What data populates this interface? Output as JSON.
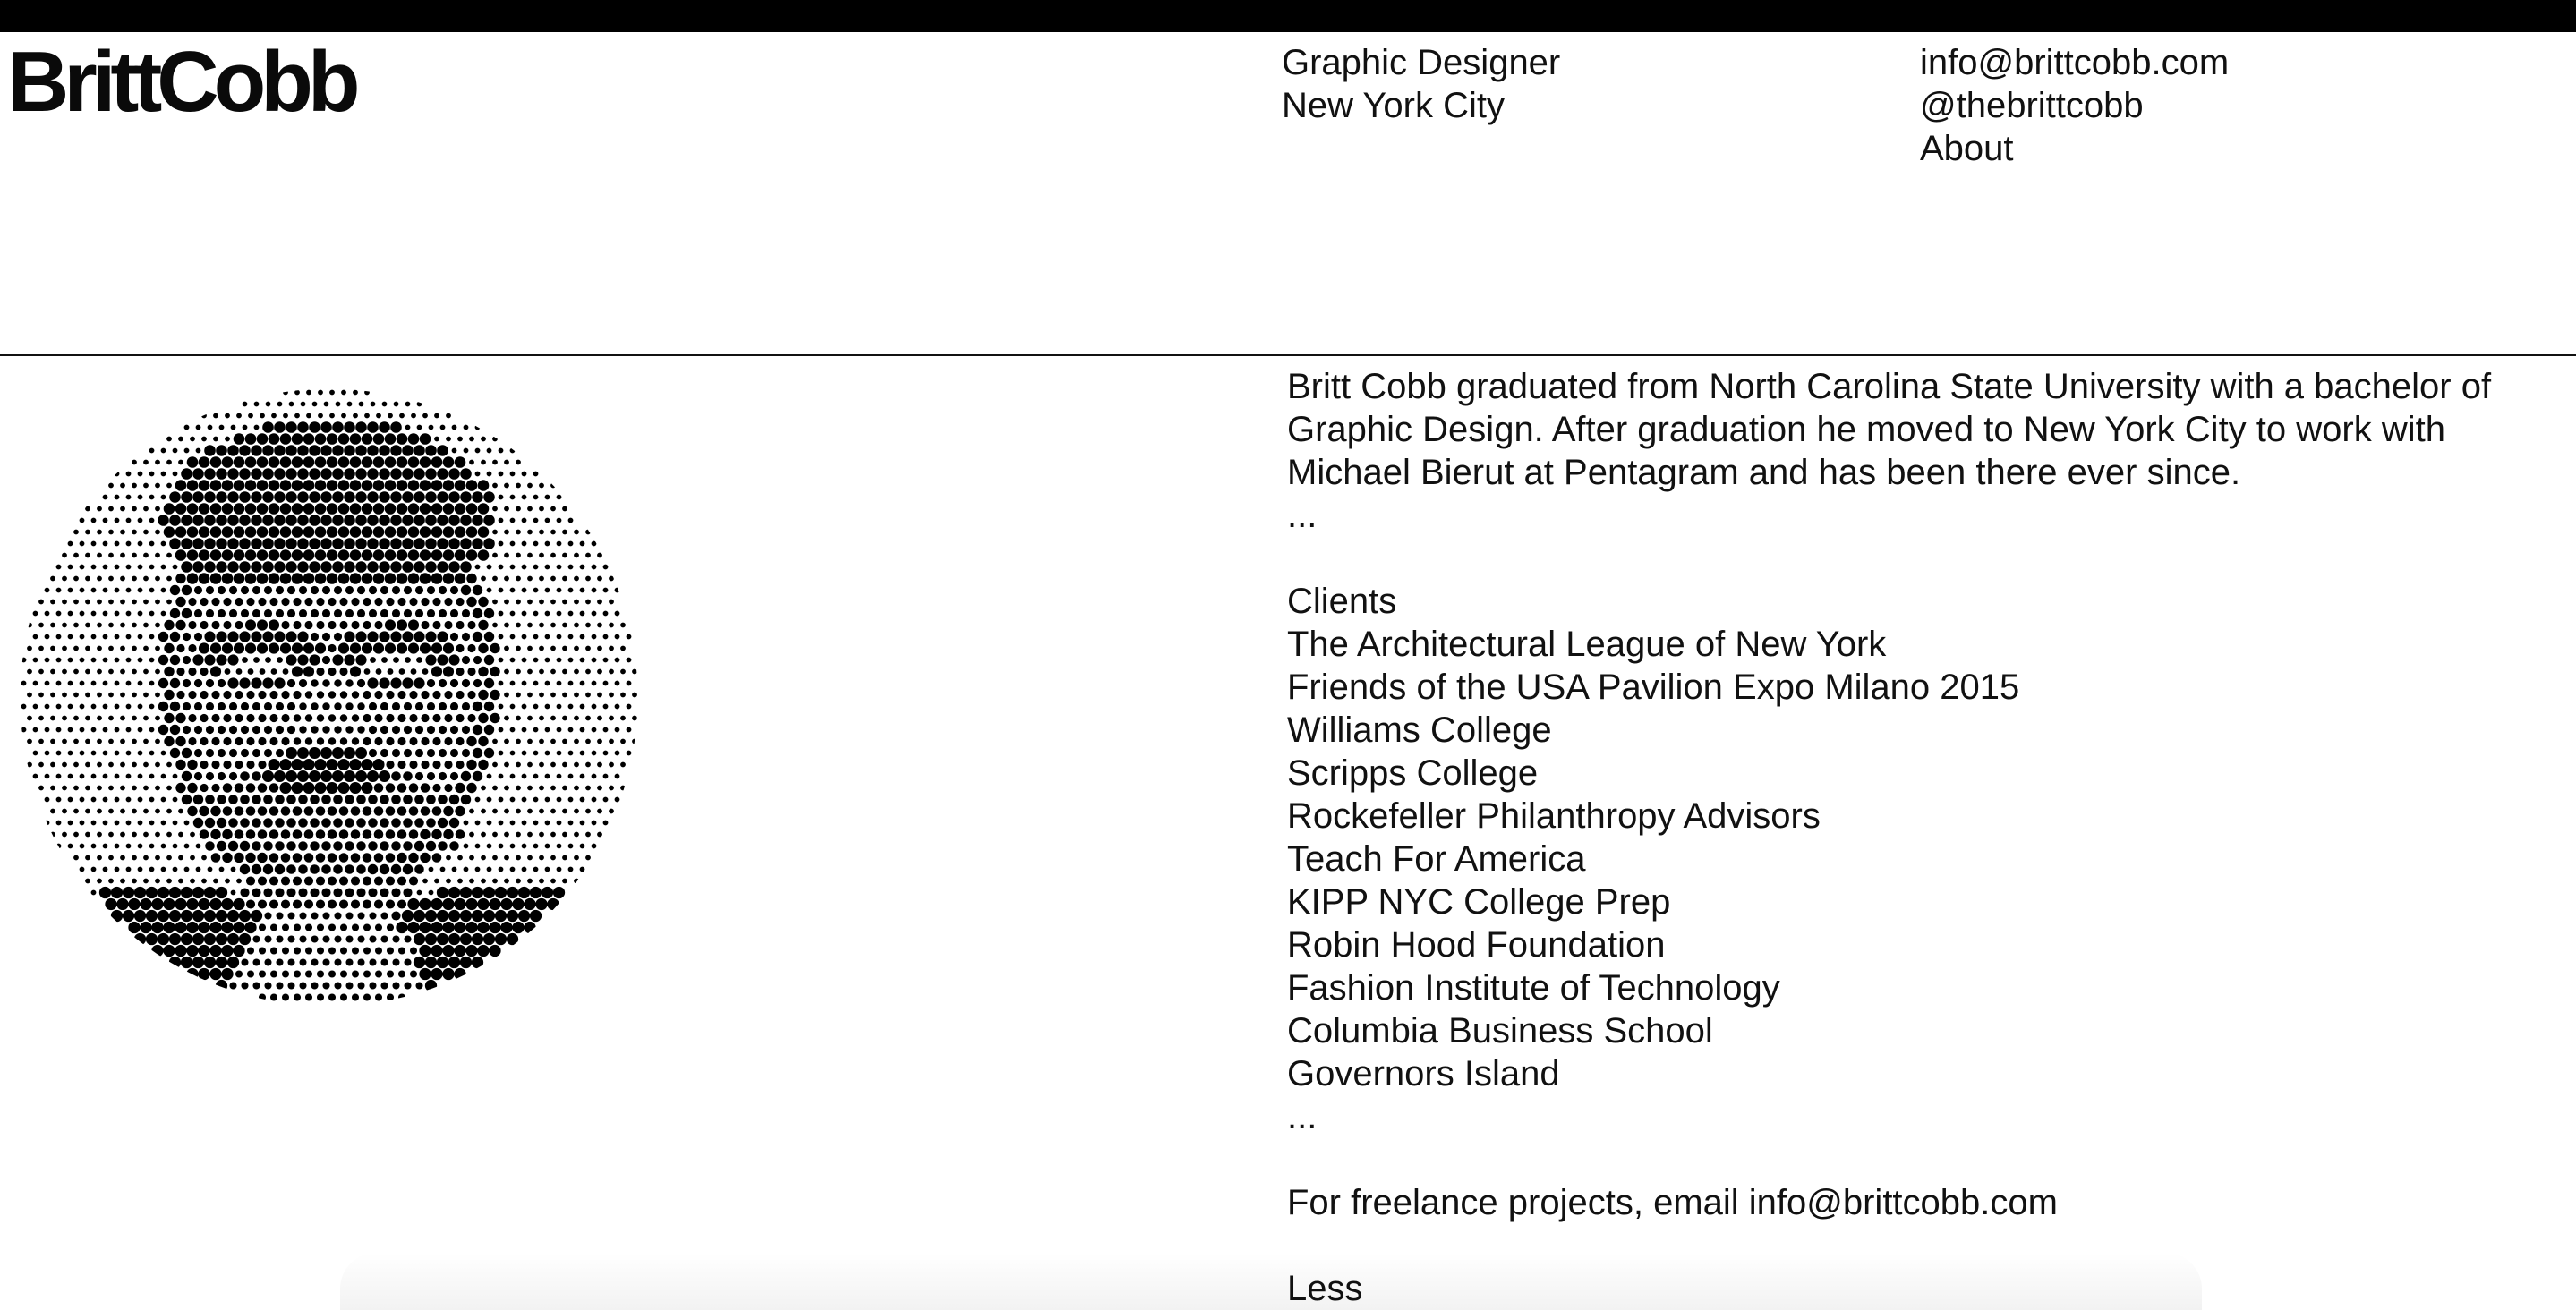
{
  "site": {
    "logo": "BrittCobb"
  },
  "header": {
    "role": "Graphic Designer",
    "city": "New York City",
    "email": "info@brittcobb.com",
    "handle": "@thebrittcobb",
    "about_label": "About"
  },
  "about": {
    "bio": "Britt Cobb graduated from North Carolina State University with a bachelor of Graphic Design. After graduation he moved to New York City to work with Michael Bierut at Pentagram and has been there ever since.",
    "bio_more": "...",
    "clients_heading": "Clients",
    "clients": [
      "The Architectural League of New York",
      "Friends of the USA Pavilion Expo Milano 2015",
      "Williams College",
      "Scripps College",
      "Rockefeller Philanthropy Advisors",
      "Teach For America",
      "KIPP NYC College Prep",
      "Robin Hood Foundation",
      "Fashion Institute of Technology",
      "Columbia Business School",
      "Governors Island"
    ],
    "clients_more": "...",
    "freelance": "For freelance projects, email info@brittcobb.com",
    "less_label": "Less"
  },
  "colors": {
    "text": "#111111",
    "background": "#ffffff",
    "topbar": "#000000"
  },
  "icons": {
    "portrait": "halftone-portrait"
  }
}
